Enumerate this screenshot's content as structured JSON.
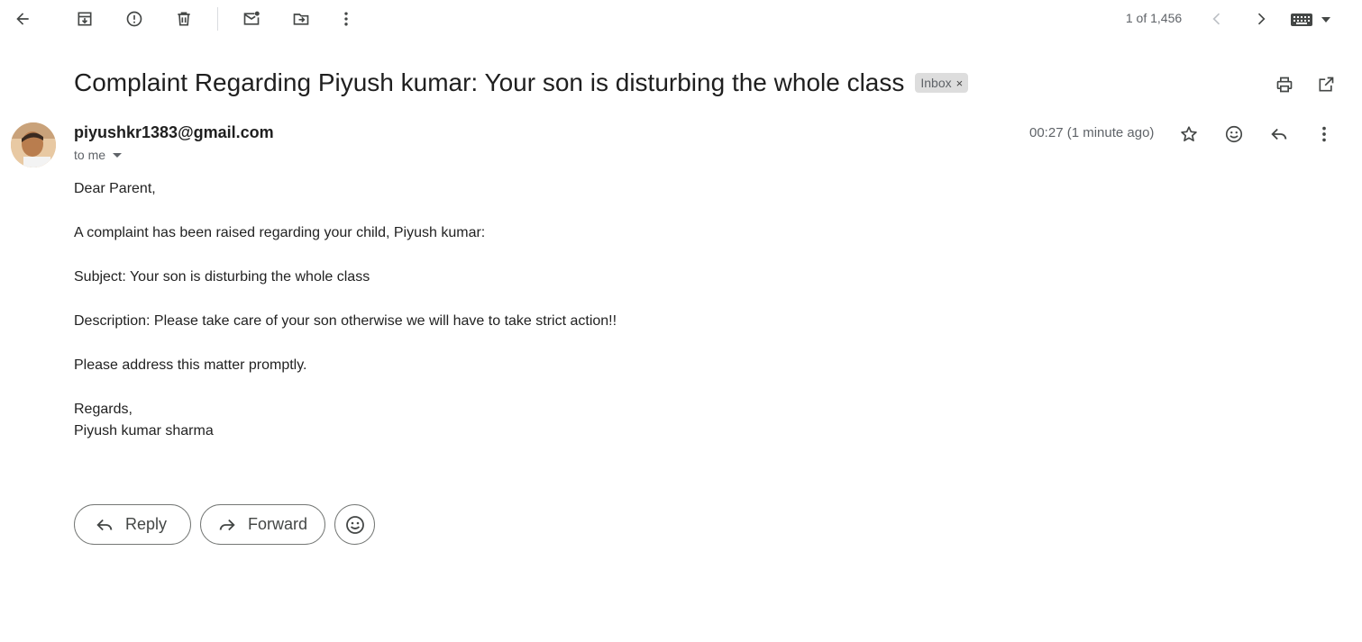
{
  "toolbar": {
    "icons": [
      "back-arrow-icon",
      "archive-icon",
      "report-spam-icon",
      "delete-icon",
      "mark-unread-icon",
      "move-to-icon",
      "more-vert-icon"
    ],
    "pager": "1 of 1,456",
    "nav": [
      "chevron-left-icon",
      "chevron-right-icon"
    ],
    "input_tools": "keyboard-icon"
  },
  "email": {
    "subject": "Complaint Regarding Piyush kumar: Your son is disturbing the whole class",
    "label": "Inbox",
    "label_remove": "×",
    "sender": "piyushkr1383@gmail.com",
    "recipient": "to me",
    "time": "00:27 (1 minute ago)",
    "body": {
      "greeting": "Dear Parent,",
      "line1": "A complaint has been raised regarding your child, Piyush kumar:",
      "line2": "Subject: Your son is disturbing the whole class",
      "line3": "Description: Please take care of your son otherwise we will have to take strict action!!",
      "line4": "Please address this matter promptly.",
      "closing": "Regards,",
      "signature": "Piyush kumar sharma"
    }
  },
  "actions": {
    "reply_label": "Reply",
    "forward_label": "Forward"
  },
  "colors": {
    "text": "#202124",
    "muted": "#5f6368",
    "chip": "#dddddd"
  }
}
